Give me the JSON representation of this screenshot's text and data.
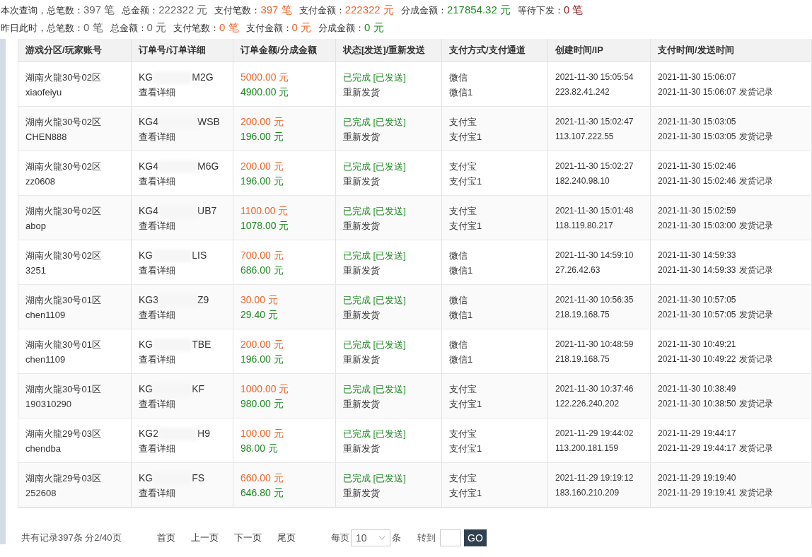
{
  "summary": [
    [
      {
        "label": "本次查询，总笔数：",
        "value": "397 笔",
        "color": "#666666"
      },
      {
        "label": "总金额：",
        "value": "222322 元",
        "color": "#666666"
      },
      {
        "label": "支付笔数：",
        "value": "397 笔",
        "color": "#f0652b"
      },
      {
        "label": "支付金额：",
        "value": "222322 元",
        "color": "#f0652b"
      },
      {
        "label": "分成金额：",
        "value": "217854.32 元",
        "color": "#1f8b24"
      },
      {
        "label": "等待下发：",
        "value": "0 笔",
        "color": "#8b1a1a"
      }
    ],
    [
      {
        "label": "昨日此时，总笔数：",
        "value": "0 笔",
        "color": "#666666"
      },
      {
        "label": "总金额：",
        "value": "0 元",
        "color": "#666666"
      },
      {
        "label": "支付笔数：",
        "value": "0 笔",
        "color": "#f0652b"
      },
      {
        "label": "支付金额：",
        "value": "0 元",
        "color": "#f0652b"
      },
      {
        "label": "分成金额：",
        "value": "0 元",
        "color": "#1f8b24"
      }
    ]
  ],
  "table": {
    "columns": [
      "游戏分区/玩家账号",
      "订单号/订单详细",
      "订单金额/分成金额",
      "状态[发送]/重新发送",
      "支付方式/支付通道",
      "创建时间/IP",
      "支付时间/发送时间"
    ],
    "rows": [
      {
        "zone": "湖南火龍30号02区",
        "account": "xiaofeiyu",
        "order_start": "KG",
        "order_end": "M2G",
        "detail": "查看详细",
        "amount": "5000.00 元",
        "share": "4900.00 元",
        "status": "已完成 [已发送]",
        "resend": "重新发货",
        "method": "微信",
        "channel": "微信1",
        "created": "2021-11-30 15:05:54",
        "ip": "223.82.41.242",
        "paid": "2021-11-30 15:06:07",
        "sent": "2021-11-30 15:06:07",
        "log": "发货记录"
      },
      {
        "zone": "湖南火龍30号02区",
        "account": "CHEN888",
        "order_start": "KG4",
        "order_end": "WSB",
        "detail": "查看详细",
        "amount": "200.00 元",
        "share": "196.00 元",
        "status": "已完成 [已发送]",
        "resend": "重新发货",
        "method": "支付宝",
        "channel": "支付宝1",
        "created": "2021-11-30 15:02:47",
        "ip": "113.107.222.55",
        "paid": "2021-11-30 15:03:05",
        "sent": "2021-11-30 15:03:05",
        "log": "发货记录"
      },
      {
        "zone": "湖南火龍30号02区",
        "account": "zz0608",
        "order_start": "KG4",
        "order_end": "M6G",
        "detail": "查看详细",
        "amount": "200.00 元",
        "share": "196.00 元",
        "status": "已完成 [已发送]",
        "resend": "重新发货",
        "method": "支付宝",
        "channel": "支付宝1",
        "created": "2021-11-30 15:02:27",
        "ip": "182.240.98.10",
        "paid": "2021-11-30 15:02:46",
        "sent": "2021-11-30 15:02:46",
        "log": "发货记录"
      },
      {
        "zone": "湖南火龍30号02区",
        "account": "abop",
        "order_start": "KG4",
        "order_end": "UB7",
        "detail": "查看详细",
        "amount": "1100.00 元",
        "share": "1078.00 元",
        "status": "已完成 [已发送]",
        "resend": "重新发货",
        "method": "支付宝",
        "channel": "支付宝1",
        "created": "2021-11-30 15:01:48",
        "ip": "118.119.80.217",
        "paid": "2021-11-30 15:02:59",
        "sent": "2021-11-30 15:03:00",
        "log": "发货记录"
      },
      {
        "zone": "湖南火龍30号02区",
        "account": "3251",
        "order_start": "KG",
        "order_end": "LIS",
        "detail": "查看详细",
        "amount": "700.00 元",
        "share": "686.00 元",
        "status": "已完成 [已发送]",
        "resend": "重新发货",
        "method": "微信",
        "channel": "微信1",
        "created": "2021-11-30 14:59:10",
        "ip": "27.26.42.63",
        "paid": "2021-11-30 14:59:33",
        "sent": "2021-11-30 14:59:33",
        "log": "发货记录"
      },
      {
        "zone": "湖南火龍30号01区",
        "account": "chen1109",
        "order_start": "KG3",
        "order_end": "Z9",
        "detail": "查看详细",
        "amount": "30.00 元",
        "share": "29.40 元",
        "status": "已完成 [已发送]",
        "resend": "重新发货",
        "method": "微信",
        "channel": "微信1",
        "created": "2021-11-30 10:56:35",
        "ip": "218.19.168.75",
        "paid": "2021-11-30 10:57:05",
        "sent": "2021-11-30 10:57:05",
        "log": "发货记录"
      },
      {
        "zone": "湖南火龍30号01区",
        "account": "chen1109",
        "order_start": "KG",
        "order_end": "TBE",
        "detail": "查看详细",
        "amount": "200.00 元",
        "share": "196.00 元",
        "status": "已完成 [已发送]",
        "resend": "重新发货",
        "method": "微信",
        "channel": "微信1",
        "created": "2021-11-30 10:48:59",
        "ip": "218.19.168.75",
        "paid": "2021-11-30 10:49:21",
        "sent": "2021-11-30 10:49:22",
        "log": "发货记录"
      },
      {
        "zone": "湖南火龍30号01区",
        "account": "190310290",
        "order_start": "KG",
        "order_end": "KF",
        "detail": "查看详细",
        "amount": "1000.00 元",
        "share": "980.00 元",
        "status": "已完成 [已发送]",
        "resend": "重新发货",
        "method": "支付宝",
        "channel": "支付宝1",
        "created": "2021-11-30 10:37:46",
        "ip": "122.226.240.202",
        "paid": "2021-11-30 10:38:49",
        "sent": "2021-11-30 10:38:50",
        "log": "发货记录"
      },
      {
        "zone": "湖南火龍29号03区",
        "account": "chendba",
        "order_start": "KG2",
        "order_end": "H9",
        "detail": "查看详细",
        "amount": "100.00 元",
        "share": "98.00 元",
        "status": "已完成 [已发送]",
        "resend": "重新发货",
        "method": "支付宝",
        "channel": "支付宝1",
        "created": "2021-11-29 19:44:02",
        "ip": "113.200.181.159",
        "paid": "2021-11-29 19:44:17",
        "sent": "2021-11-29 19:44:17",
        "log": "发货记录"
      },
      {
        "zone": "湖南火龍29号03区",
        "account": "252608",
        "order_start": "KG",
        "order_end": "FS",
        "detail": "查看详细",
        "amount": "660.00 元",
        "share": "646.80 元",
        "status": "已完成 [已发送]",
        "resend": "重新发货",
        "method": "支付宝",
        "channel": "支付宝1",
        "created": "2021-11-29 19:19:12",
        "ip": "183.160.210.209",
        "paid": "2021-11-29 19:19:40",
        "sent": "2021-11-29 19:19:41",
        "log": "发货记录"
      }
    ]
  },
  "pagination": {
    "info": "共有记录397条 分2/40页",
    "links": [
      "首页",
      "上一页",
      "下一页",
      "尾页"
    ],
    "per_page_label": "每页",
    "per_page": "10",
    "per_page_unit": "条",
    "goto_label": "转到",
    "go": "GO"
  }
}
